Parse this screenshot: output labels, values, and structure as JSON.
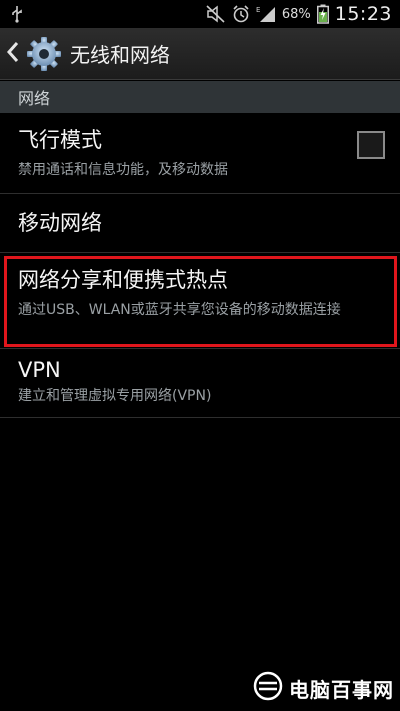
{
  "status_bar": {
    "battery_percent": "68%",
    "time": "15:23",
    "icons": [
      "usb-icon",
      "mute-icon",
      "alarm-icon",
      "signal-icon",
      "battery-icon"
    ]
  },
  "action_bar": {
    "title": "无线和网络",
    "icon": "settings-gear-icon"
  },
  "section": {
    "label": "网络"
  },
  "items": [
    {
      "title": "飞行模式",
      "summary": "禁用通话和信息功能，及移动数据",
      "has_checkbox": true,
      "checked": false
    },
    {
      "title": "移动网络",
      "summary": ""
    },
    {
      "title": "网络分享和便携式热点",
      "summary": "通过USB、WLAN或蓝牙共享您设备的移动数据连接"
    },
    {
      "title": "VPN",
      "summary": "建立和管理虚拟专用网络(VPN)"
    }
  ],
  "watermark": {
    "text": "电脑百事网"
  },
  "colors": {
    "highlight": "#e0161c",
    "section_bg": "#2f3437"
  }
}
